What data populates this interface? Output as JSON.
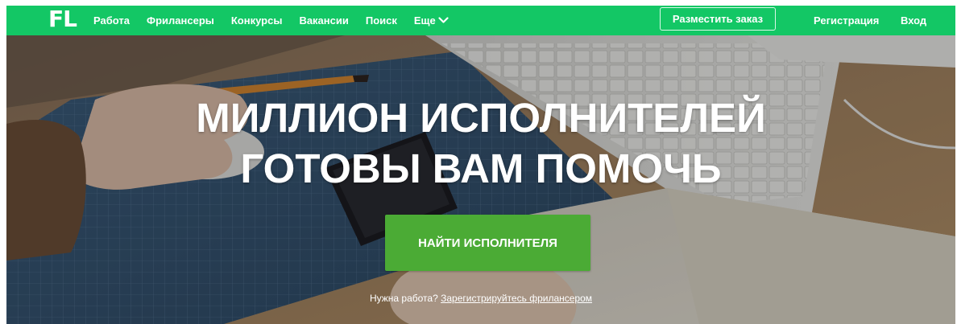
{
  "header": {
    "logo": "FL",
    "nav": [
      {
        "label": "Работа"
      },
      {
        "label": "Фрилансеры"
      },
      {
        "label": "Конкурсы"
      },
      {
        "label": "Вакансии"
      },
      {
        "label": "Поиск"
      },
      {
        "label": "Еще"
      }
    ],
    "post_order": "Разместить заказ",
    "register": "Регистрация",
    "login": "Вход"
  },
  "hero": {
    "headline_line1": "МИЛЛИОН ИСПОЛНИТЕЛЕЙ",
    "headline_line2": "ГОТОВЫ ВАМ ПОМОЧЬ",
    "cta": "НАЙТИ ИСПОЛНИТЕЛЯ",
    "freelancer_question": "Нужна работа?",
    "freelancer_link": "Зарегистрируйтесь фрилансером"
  },
  "colors": {
    "brand_green": "#13c765",
    "cta_green": "#4bab35"
  },
  "icons": {
    "more_chevron": "chevron-down-icon"
  }
}
